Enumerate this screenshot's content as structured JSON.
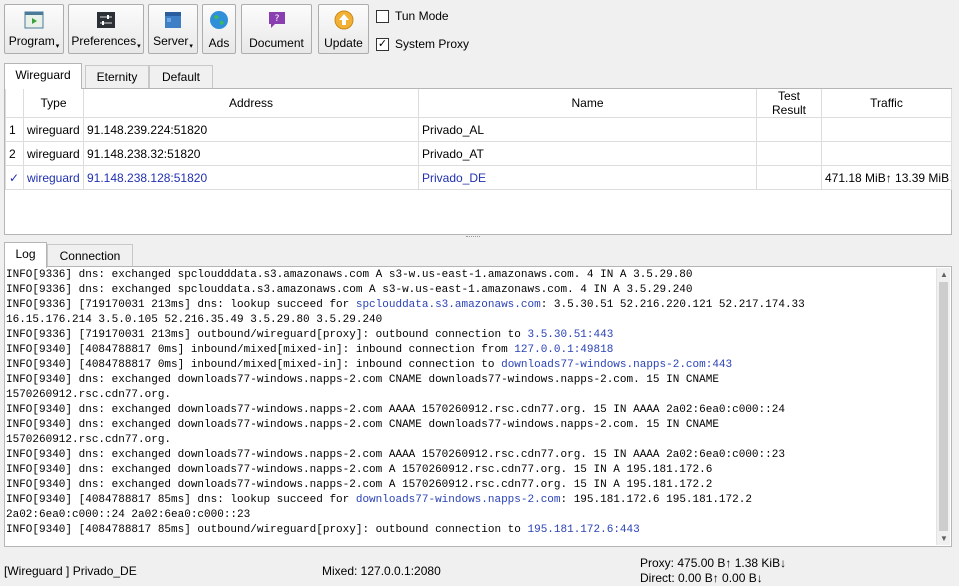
{
  "toolbar": {
    "program": "Program",
    "preferences": "Preferences",
    "server": "Server",
    "ads": "Ads",
    "document": "Document",
    "update": "Update",
    "tun_mode": "Tun Mode",
    "tun_mode_checked": false,
    "system_proxy": "System Proxy",
    "system_proxy_checked": true,
    "check_mark": "✓"
  },
  "group_tabs": [
    "Wireguard",
    "Eternity",
    "Default"
  ],
  "server_table": {
    "columns": [
      "",
      "Type",
      "Address",
      "Name",
      "Test Result",
      "Traffic"
    ],
    "rows": [
      {
        "index": "1",
        "type": "wireguard",
        "address": "91.148.239.224:51820",
        "name": "Privado_AL",
        "test_result": "",
        "traffic": ""
      },
      {
        "index": "2",
        "type": "wireguard",
        "address": "91.148.238.32:51820",
        "name": "Privado_AT",
        "test_result": "",
        "traffic": ""
      },
      {
        "index": "✓",
        "type": "wireguard",
        "address": "91.148.238.128:51820",
        "name": "Privado_DE",
        "test_result": "",
        "traffic": "471.18 MiB↑ 13.39 MiB↓"
      }
    ]
  },
  "log_tabs": [
    "Log",
    "Connection"
  ],
  "log_lines": [
    [
      {
        "t": "INFO[9336] dns: exchanged spcloudddata.s3.amazonaws.com A s3-w.us-east-1.amazonaws.com. 4 IN A 3.5.29.80"
      }
    ],
    [
      {
        "t": "INFO[9336] dns: exchanged spclouddata.s3.amazonaws.com A s3-w.us-east-1.amazonaws.com. 4 IN A 3.5.29.240"
      }
    ],
    [
      {
        "t": "INFO[9336] [719170031 213ms] dns: lookup succeed for "
      },
      {
        "t": "spclouddata.s3.amazonaws.com",
        "h": true
      },
      {
        "t": ": 3.5.30.51 52.216.220.121 52.217.174.33"
      }
    ],
    [
      {
        "t": "16.15.176.214 3.5.0.105 52.216.35.49 3.5.29.80 3.5.29.240"
      }
    ],
    [
      {
        "t": "INFO[9336] [719170031 213ms] outbound/wireguard[proxy]: outbound connection to "
      },
      {
        "t": "3.5.30.51:443",
        "h": true
      }
    ],
    [
      {
        "t": "INFO[9340] [4084788817 0ms] inbound/mixed[mixed-in]: inbound connection from "
      },
      {
        "t": "127.0.0.1:49818",
        "h": true
      }
    ],
    [
      {
        "t": "INFO[9340] [4084788817 0ms] inbound/mixed[mixed-in]: inbound connection to "
      },
      {
        "t": "downloads77-windows.napps-2.com:443",
        "h": true
      }
    ],
    [
      {
        "t": "INFO[9340] dns: exchanged downloads77-windows.napps-2.com CNAME downloads77-windows.napps-2.com. 15 IN CNAME"
      }
    ],
    [
      {
        "t": "1570260912.rsc.cdn77.org."
      }
    ],
    [
      {
        "t": "INFO[9340] dns: exchanged downloads77-windows.napps-2.com AAAA 1570260912.rsc.cdn77.org. 15 IN AAAA 2a02:6ea0:c000::24"
      }
    ],
    [
      {
        "t": "INFO[9340] dns: exchanged downloads77-windows.napps-2.com CNAME downloads77-windows.napps-2.com. 15 IN CNAME"
      }
    ],
    [
      {
        "t": "1570260912.rsc.cdn77.org."
      }
    ],
    [
      {
        "t": "INFO[9340] dns: exchanged downloads77-windows.napps-2.com AAAA 1570260912.rsc.cdn77.org. 15 IN AAAA 2a02:6ea0:c000::23"
      }
    ],
    [
      {
        "t": "INFO[9340] dns: exchanged downloads77-windows.napps-2.com A 1570260912.rsc.cdn77.org. 15 IN A 195.181.172.6"
      }
    ],
    [
      {
        "t": "INFO[9340] dns: exchanged downloads77-windows.napps-2.com A 1570260912.rsc.cdn77.org. 15 IN A 195.181.172.2"
      }
    ],
    [
      {
        "t": "INFO[9340] [4084788817 85ms] dns: lookup succeed for "
      },
      {
        "t": "downloads77-windows.napps-2.com",
        "h": true
      },
      {
        "t": ": 195.181.172.6 195.181.172.2"
      }
    ],
    [
      {
        "t": "2a02:6ea0:c000::24 2a02:6ea0:c000::23"
      }
    ],
    [
      {
        "t": "INFO[9340] [4084788817 85ms] outbound/wireguard[proxy]: outbound connection to "
      },
      {
        "t": "195.181.172.6:443",
        "h": true
      }
    ]
  ],
  "status": {
    "current": "[Wireguard ] Privado_DE",
    "mixed": "Mixed: 127.0.0.1:2080",
    "proxy": "Proxy: 475.00 B↑ 1.38 KiB↓",
    "direct": "Direct: 0.00 B↑ 0.00 B↓"
  },
  "icons": {
    "program": "program-window-icon",
    "preferences": "preferences-sliders-icon",
    "server": "server-icon",
    "ads": "globe-icon",
    "document": "document-help-icon",
    "update": "update-arrow-icon"
  },
  "colors": {
    "link": "#2a42b5",
    "selected_row": "#2030b0"
  }
}
